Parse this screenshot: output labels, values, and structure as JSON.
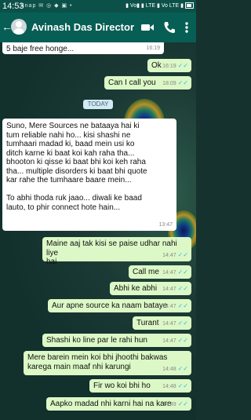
{
  "status": {
    "time": "14:53",
    "left_icons": "Snap ✉ ◎ ◆ ▣ •",
    "right": "▮ Vo▮ ▮ LTE ▮ Vo LTE ▮"
  },
  "header": {
    "title": "Avinash Das Director"
  },
  "date_label": "TODAY",
  "messages": [
    {
      "dir": "in",
      "text": "5 baje free honge...",
      "time": "16:19"
    },
    {
      "dir": "out",
      "text": "Ok",
      "time": "16:19"
    },
    {
      "dir": "out",
      "text": "Can I call you",
      "time": "18:09"
    },
    {
      "dir": "in",
      "text": "Suno, Mere Sources ne bataaya hai ki\ntum reliable nahi ho... kisi shashi ne\ntumhaari madad ki, baad mein usi ko\nditch karne ki baat koi kah raha tha...\nbhooton ki qisse ki baat bhi koi keh raha\ntha... multiple disorders ki baat bhi quote\nkar rahe the tumhaare baare mein...\n\nTo abhi thoda ruk jaao... diwali ke baad\nlauto, to phir connect hote hain...",
      "time": "13:47"
    },
    {
      "dir": "out",
      "text": "Maine aaj tak kisi se paise udhar nahi liye\nhai",
      "time": "14:47"
    },
    {
      "dir": "out",
      "text": "Call me",
      "time": "14:47"
    },
    {
      "dir": "out",
      "text": "Abhi ke abhi",
      "time": "14:47"
    },
    {
      "dir": "out",
      "text": "Aur apne source ka naam bataye",
      "time": "14:47"
    },
    {
      "dir": "out",
      "text": "Turant",
      "time": "14:47"
    },
    {
      "dir": "out",
      "text": "Shashi ko line par le rahi hun",
      "time": "14:47"
    },
    {
      "dir": "out",
      "text": "Mere barein mein koi bhi jhoothi bakwas\nkarega main maaf nhi karungi",
      "time": "14:48"
    },
    {
      "dir": "out",
      "text": "Fir wo koi bhi ho",
      "time": "14:48"
    },
    {
      "dir": "out",
      "text": "Aapko madad nhi karni hai na kare",
      "time": "14:49"
    }
  ],
  "colors": {
    "appbar": "#075e54",
    "outgoing": "#dcf8c6",
    "incoming": "#ffffff",
    "read_tick": "#34b7f1"
  }
}
